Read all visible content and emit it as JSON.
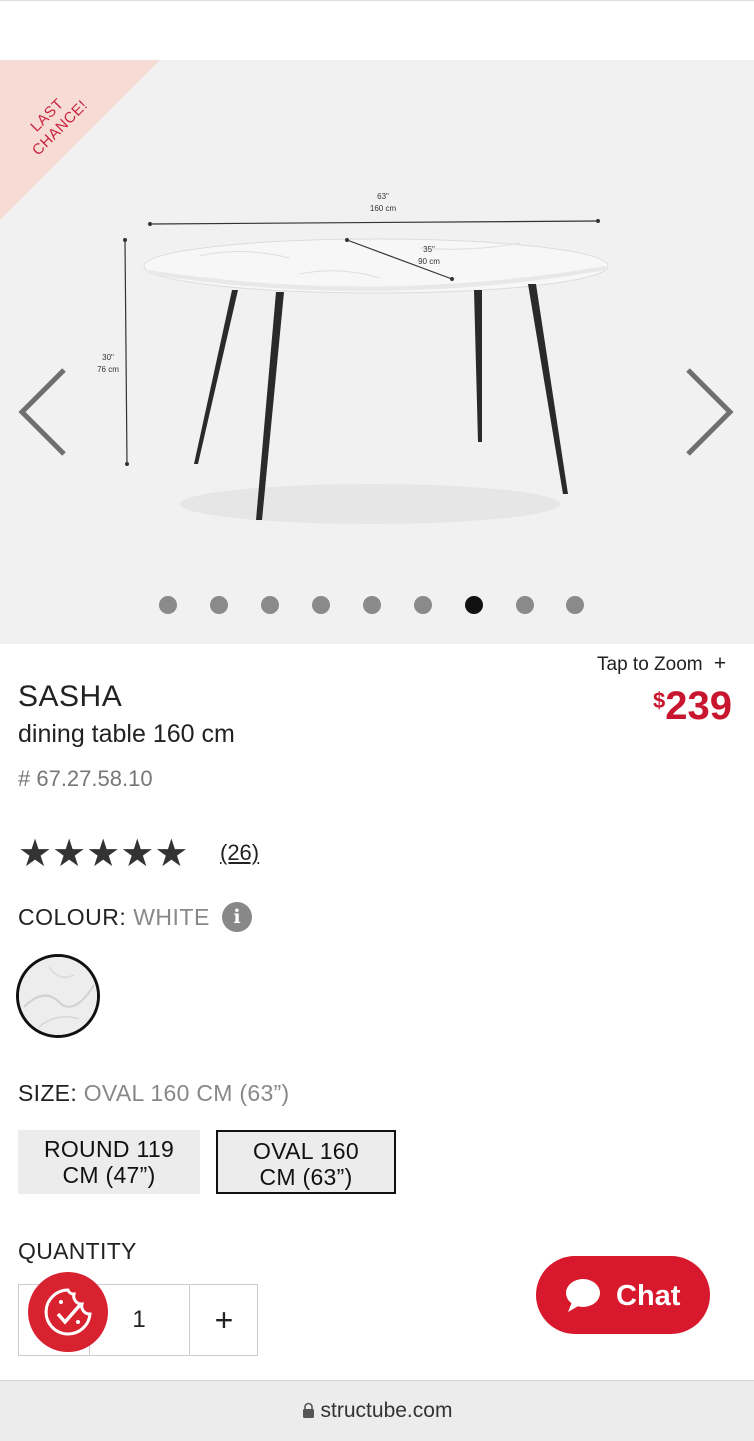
{
  "gallery": {
    "badge": [
      "LAST",
      "CHANCE!"
    ],
    "dimensions": {
      "length": [
        "63\"",
        "160 cm"
      ],
      "depth": [
        "35\"",
        "90 cm"
      ],
      "height": [
        "30\"",
        "76 cm"
      ]
    },
    "dots_total": 9,
    "dots_active_index": 6
  },
  "product": {
    "tap_to_zoom": "Tap to Zoom",
    "price_currency": "$",
    "price_amount": "239",
    "name": "SASHA",
    "subtitle": "dining table 160 cm",
    "sku": "# 67.27.58.10",
    "rating_stars": 5,
    "reviews_count": "(26)"
  },
  "colour": {
    "label": "COLOUR:",
    "value": "WHITE"
  },
  "size": {
    "label": "SIZE:",
    "value": "OVAL 160 CM (63”)",
    "options": [
      {
        "line1": "ROUND 119",
        "line2": "CM (47”)"
      },
      {
        "line1": "OVAL 160",
        "line2": "CM (63”)"
      }
    ]
  },
  "quantity": {
    "label": "QUANTITY",
    "value": "1",
    "plus": "+"
  },
  "chat": {
    "label": "Chat"
  },
  "browser": {
    "url": "structube.com"
  },
  "colors": {
    "accent": "#d8182c",
    "price": "#c9162f"
  }
}
